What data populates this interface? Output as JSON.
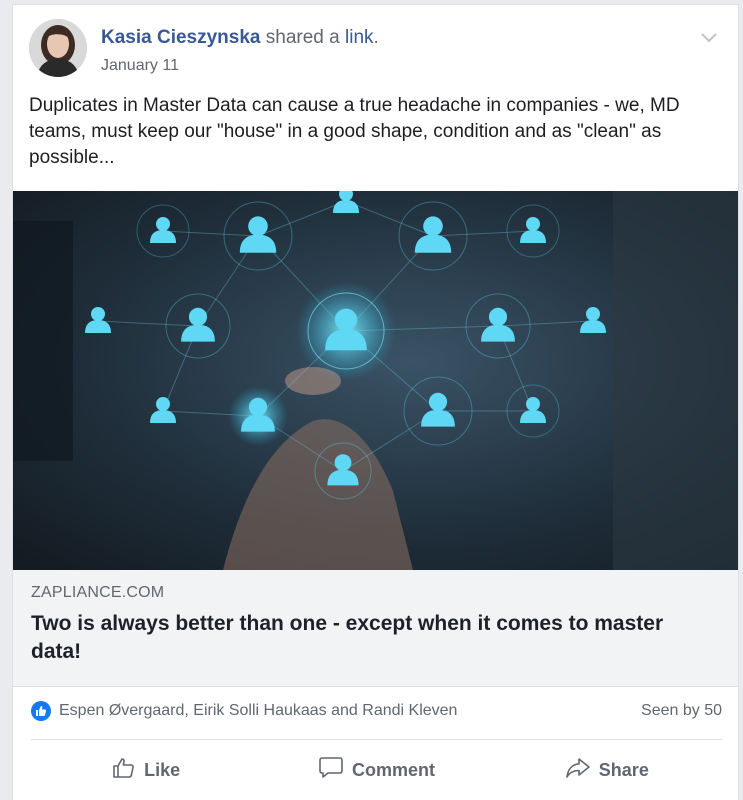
{
  "post": {
    "author": "Kasia Cieszynska",
    "shared_text": " shared a ",
    "link_word": "link",
    "period": ".",
    "date": "January 11",
    "text": "Duplicates in Master Data can cause a true headache in companies - we, MD teams, must keep our \"house\" in a good shape, condition and as \"clean\" as possible..."
  },
  "link_preview": {
    "domain": "ZAPLIANCE.COM",
    "title": "Two is always better than one - except when it comes to master data!"
  },
  "reactions": {
    "names": "Espen Øvergaard, Eirik Solli Haukaas and Randi Kleven",
    "seen": "Seen by 50"
  },
  "actions": {
    "like": "Like",
    "comment": "Comment",
    "share": "Share"
  },
  "colors": {
    "link_blue": "#385898",
    "like_blue": "#1877f2",
    "muted": "#606770"
  }
}
